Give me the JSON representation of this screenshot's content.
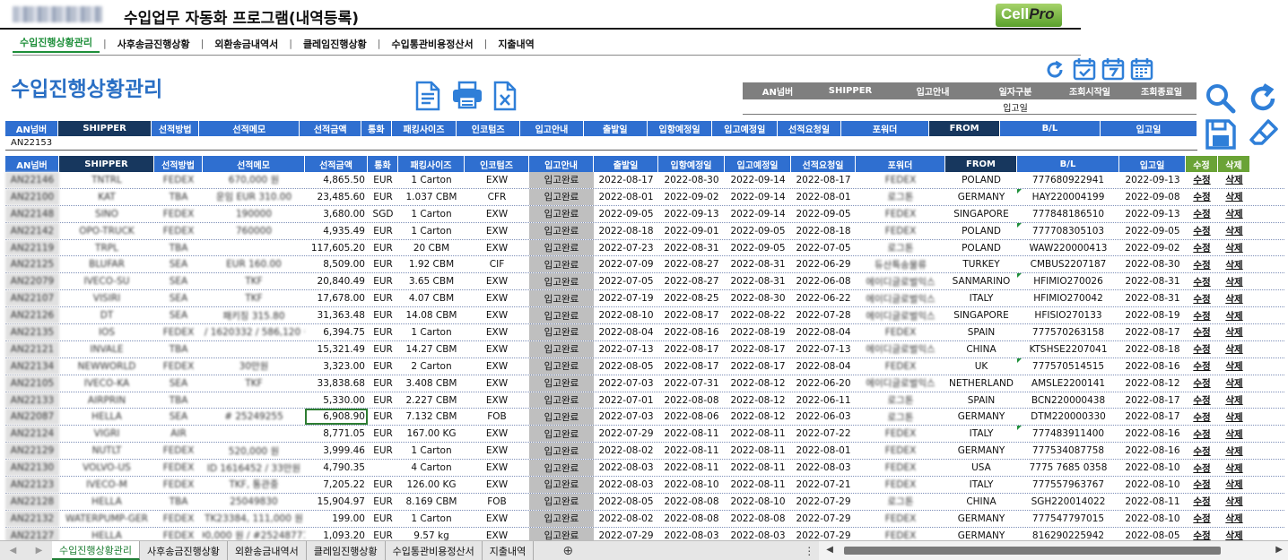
{
  "app": {
    "title": "수입업무 자동화 프로그램(내역등록)",
    "brand_logo": "CellPro",
    "brand_main": "Cell",
    "brand_pro": "Pro"
  },
  "nav": [
    {
      "label": "수입진행상황관리",
      "active": true
    },
    {
      "label": "사후송금진행상황",
      "active": false
    },
    {
      "label": "외환송금내역서",
      "active": false
    },
    {
      "label": "클레임진행상황",
      "active": false
    },
    {
      "label": "수입통관비용정산서",
      "active": false
    },
    {
      "label": "지출내역",
      "active": false
    }
  ],
  "page_title": "수입진행상황관리",
  "icons": {
    "top_toolbar": [
      "document-icon",
      "printer-icon",
      "excel-export-icon"
    ],
    "right_top": [
      "refresh-icon",
      "calendar-check-icon",
      "calendar-7-icon",
      "calendar-month-icon"
    ],
    "right_side": [
      "search-icon",
      "reload-icon",
      "save-icon",
      "eraser-icon"
    ]
  },
  "filter": {
    "headers": [
      "AN넘버",
      "SHIPPER",
      "입고안내",
      "일자구분",
      "조회시작일",
      "조회종료일"
    ],
    "values": [
      "",
      "",
      "",
      "입고일",
      "",
      ""
    ]
  },
  "entry": {
    "headers": [
      "AN넘버",
      "SHIPPER",
      "선적방법",
      "선적메모",
      "선적금액",
      "통화",
      "패킹사이즈",
      "인코텀즈",
      "입고안내",
      "출발일",
      "입항예정일",
      "입고예정일",
      "선적요청일",
      "포워더",
      "FROM",
      "B/L",
      "입고일"
    ],
    "values": [
      "AN22153",
      "",
      "",
      "",
      "",
      "",
      "",
      "",
      "",
      "",
      "",
      "",
      "",
      "",
      "",
      "",
      ""
    ]
  },
  "table": {
    "headers": [
      "AN넘버",
      "SHIPPER",
      "선적방법",
      "선적메모",
      "선적금액",
      "통화",
      "패킹사이즈",
      "인코텀즈",
      "입고안내",
      "출발일",
      "입항예정일",
      "입고예정일",
      "선적요청일",
      "포워더",
      "FROM",
      "B/L",
      "입고일",
      "수정",
      "삭제"
    ],
    "rows": [
      [
        "AN22146",
        "TNTRL",
        "FEDEX",
        "670,000 원",
        "4,865.50",
        "EUR",
        "1 Carton",
        "EXW",
        "입고완료",
        "2022-08-17",
        "2022-08-30",
        "2022-09-14",
        "2022-08-17",
        "FEDEX",
        "POLAND",
        "777680922941",
        "2022-09-13",
        "수정",
        "삭제"
      ],
      [
        "AN22100",
        "KAT",
        "TBA",
        "운임 EUR 310.00",
        "23,485.60",
        "EUR",
        "1.037 CBM",
        "CFR",
        "입고완료",
        "2022-08-01",
        "2022-09-02",
        "2022-09-14",
        "2022-08-01",
        "로그톤",
        "GERMANY",
        "HAY220004199",
        "2022-09-08",
        "수정",
        "삭제"
      ],
      [
        "AN22148",
        "SINO",
        "FEDEX",
        "190000",
        "3,680.00",
        "SGD",
        "1 Carton",
        "EXW",
        "입고완료",
        "2022-09-05",
        "2022-09-13",
        "2022-09-14",
        "2022-09-05",
        "FEDEX",
        "SINGAPORE",
        "777848186510",
        "2022-09-13",
        "수정",
        "삭제"
      ],
      [
        "AN22142",
        "OPO-TRUCK",
        "FEDEX",
        "760000",
        "4,935.49",
        "EUR",
        "1 Carton",
        "EXW",
        "입고완료",
        "2022-08-18",
        "2022-09-01",
        "2022-09-05",
        "2022-08-18",
        "FEDEX",
        "POLAND",
        "777708305103",
        "2022-09-05",
        "수정",
        "삭제"
      ],
      [
        "AN22119",
        "TRPL",
        "TBA",
        "",
        "117,605.20",
        "EUR",
        "20 CBM",
        "EXW",
        "입고완료",
        "2022-07-23",
        "2022-08-31",
        "2022-09-05",
        "2022-07-05",
        "로그톤",
        "POLAND",
        "WAW220000413",
        "2022-09-02",
        "수정",
        "삭제"
      ],
      [
        "AN22125",
        "BLUFAR",
        "SEA",
        "EUR 160.00",
        "8,509.00",
        "EUR",
        "1.92 CBM",
        "CIF",
        "입고완료",
        "2022-07-09",
        "2022-08-27",
        "2022-08-31",
        "2022-06-29",
        "듀산특송물류",
        "TURKEY",
        "CMBUS2207187",
        "2022-08-30",
        "수정",
        "삭제"
      ],
      [
        "AN22079",
        "IVECO-SU",
        "SEA",
        "TKF",
        "20,840.49",
        "EUR",
        "3.65 CBM",
        "EXW",
        "입고완료",
        "2022-07-05",
        "2022-08-27",
        "2022-08-31",
        "2022-06-08",
        "에이디글로벌익스",
        "SANMARINO",
        "HFIMIO270026",
        "2022-08-31",
        "수정",
        "삭제"
      ],
      [
        "AN22107",
        "VISIRI",
        "SEA",
        "TKF",
        "17,678.00",
        "EUR",
        "4.07 CBM",
        "EXW",
        "입고완료",
        "2022-07-19",
        "2022-08-25",
        "2022-08-30",
        "2022-06-22",
        "에이디글로벌익스",
        "ITALY",
        "HFIMIO270042",
        "2022-08-31",
        "수정",
        "삭제"
      ],
      [
        "AN22126",
        "DT",
        "SEA",
        "패키징 315.80",
        "31,363.48",
        "EUR",
        "14.08 CBM",
        "EXW",
        "입고완료",
        "2022-08-10",
        "2022-08-17",
        "2022-08-22",
        "2022-07-28",
        "에이디글로벌익스",
        "SINGAPORE",
        "HFISIO270133",
        "2022-08-19",
        "수정",
        "삭제"
      ],
      [
        "AN22135",
        "IOS",
        "FEDEX",
        "1 / 1620332 / 586,120 원",
        "6,394.75",
        "EUR",
        "1 Carton",
        "EXW",
        "입고완료",
        "2022-08-04",
        "2022-08-16",
        "2022-08-19",
        "2022-08-04",
        "FEDEX",
        "SPAIN",
        "777570263158",
        "2022-08-17",
        "수정",
        "삭제"
      ],
      [
        "AN22121",
        "INVALE",
        "TBA",
        "",
        "15,321.49",
        "EUR",
        "14.27 CBM",
        "EXW",
        "입고완료",
        "2022-07-13",
        "2022-08-17",
        "2022-08-17",
        "2022-07-13",
        "에이디글로벌익스",
        "CHINA",
        "KTSHSE2207041",
        "2022-08-18",
        "수정",
        "삭제"
      ],
      [
        "AN22134",
        "NEWWORLD",
        "FEDEX",
        "30만원",
        "3,323.00",
        "EUR",
        "2 Carton",
        "EXW",
        "입고완료",
        "2022-08-05",
        "2022-08-17",
        "2022-08-17",
        "2022-08-04",
        "FEDEX",
        "UK",
        "777570514515",
        "2022-08-16",
        "수정",
        "삭제"
      ],
      [
        "AN22105",
        "IVECO-KA",
        "SEA",
        "TKF",
        "33,838.68",
        "EUR",
        "3.408 CBM",
        "EXW",
        "입고완료",
        "2022-07-03",
        "2022-07-31",
        "2022-08-12",
        "2022-06-20",
        "에이디글로벌익스",
        "NETHERLAND",
        "AMSLE2200141",
        "2022-08-12",
        "수정",
        "삭제"
      ],
      [
        "AN22133",
        "AIRPRIN",
        "TBA",
        "",
        "5,330.00",
        "EUR",
        "2.227 CBM",
        "EXW",
        "입고완료",
        "2022-07-01",
        "2022-08-08",
        "2022-08-12",
        "2022-06-11",
        "로그톤",
        "SPAIN",
        "BCN220000438",
        "2022-08-17",
        "수정",
        "삭제"
      ],
      [
        "AN22087",
        "HELLA",
        "SEA",
        "# 25249255",
        "6,908.90",
        "EUR",
        "7.132 CBM",
        "FOB",
        "입고완료",
        "2022-07-03",
        "2022-08-06",
        "2022-08-12",
        "2022-06-03",
        "로그톤",
        "GERMANY",
        "DTM220000330",
        "2022-08-17",
        "수정",
        "삭제"
      ],
      [
        "AN22124",
        "VIGRI",
        "AIR",
        "",
        "8,771.05",
        "EUR",
        "167.00 KG",
        "EXW",
        "입고완료",
        "2022-07-29",
        "2022-08-11",
        "2022-08-11",
        "2022-07-22",
        "FEDEX",
        "ITALY",
        "777483911400",
        "2022-08-16",
        "수정",
        "삭제"
      ],
      [
        "AN22129",
        "NUTLT",
        "FEDEX",
        "520,000 원",
        "3,999.46",
        "EUR",
        "1 Carton",
        "EXW",
        "입고완료",
        "2022-08-02",
        "2022-08-11",
        "2022-08-11",
        "2022-08-01",
        "FEDEX",
        "GERMANY",
        "777534087758",
        "2022-08-16",
        "수정",
        "삭제"
      ],
      [
        "AN22130",
        "VOLVO-US",
        "FEDEX",
        "ID 1616452 / 33만원",
        "4,790.35",
        "",
        "4 Carton",
        "EXW",
        "입고완료",
        "2022-08-03",
        "2022-08-11",
        "2022-08-11",
        "2022-08-03",
        "FEDEX",
        "USA",
        "7775 7685 0358",
        "2022-08-10",
        "수정",
        "삭제"
      ],
      [
        "AN22123",
        "IVECO-M",
        "FEDEX",
        "TKF, 통관중",
        "7,205.22",
        "EUR",
        "126.00 KG",
        "EXW",
        "입고완료",
        "2022-08-03",
        "2022-08-10",
        "2022-08-11",
        "2022-07-21",
        "FEDEX",
        "ITALY",
        "777557963767",
        "2022-08-10",
        "수정",
        "삭제"
      ],
      [
        "AN22128",
        "HELLA",
        "TBA",
        "25049830",
        "15,904.97",
        "EUR",
        "8.169 CBM",
        "FOB",
        "입고완료",
        "2022-08-05",
        "2022-08-08",
        "2022-08-10",
        "2022-07-29",
        "로그톤",
        "CHINA",
        "SGH220014022",
        "2022-08-11",
        "수정",
        "삭제"
      ],
      [
        "AN22132",
        "WATERPUMP-GER",
        "FEDEX",
        "TK23384, 111,000 원",
        "199.00",
        "EUR",
        "1 Carton",
        "EXW",
        "입고완료",
        "2022-08-02",
        "2022-08-08",
        "2022-08-08",
        "2022-07-29",
        "FEDEX",
        "GERMANY",
        "777547797015",
        "2022-08-10",
        "수정",
        "삭제"
      ],
      [
        "AN22127",
        "HELLA",
        "FEDEX",
        "90,000 원 / #25248771",
        "1,093.20",
        "EUR",
        "9.57 kg",
        "EXW",
        "입고완료",
        "2022-07-29",
        "2022-08-03",
        "2022-08-03",
        "2022-07-29",
        "FEDEX",
        "GERMANY",
        "816290225942",
        "2022-08-05",
        "수정",
        "삭제"
      ]
    ]
  },
  "sheet_tabs": [
    {
      "label": "수입진행상황관리",
      "active": true
    },
    {
      "label": "사후송금진행상황",
      "active": false
    },
    {
      "label": "외환송금내역서",
      "active": false
    },
    {
      "label": "클레임진행상황",
      "active": false
    },
    {
      "label": "수입통관비용정산서",
      "active": false
    },
    {
      "label": "지출내역",
      "active": false
    }
  ],
  "colors": {
    "header_blue": "#2f6fd0",
    "header_navy": "#17375e",
    "header_green": "#6aa336",
    "heading_text": "#2a6fc4",
    "active_green": "#1e8f3a",
    "icon_blue": "#2f7fd8"
  }
}
